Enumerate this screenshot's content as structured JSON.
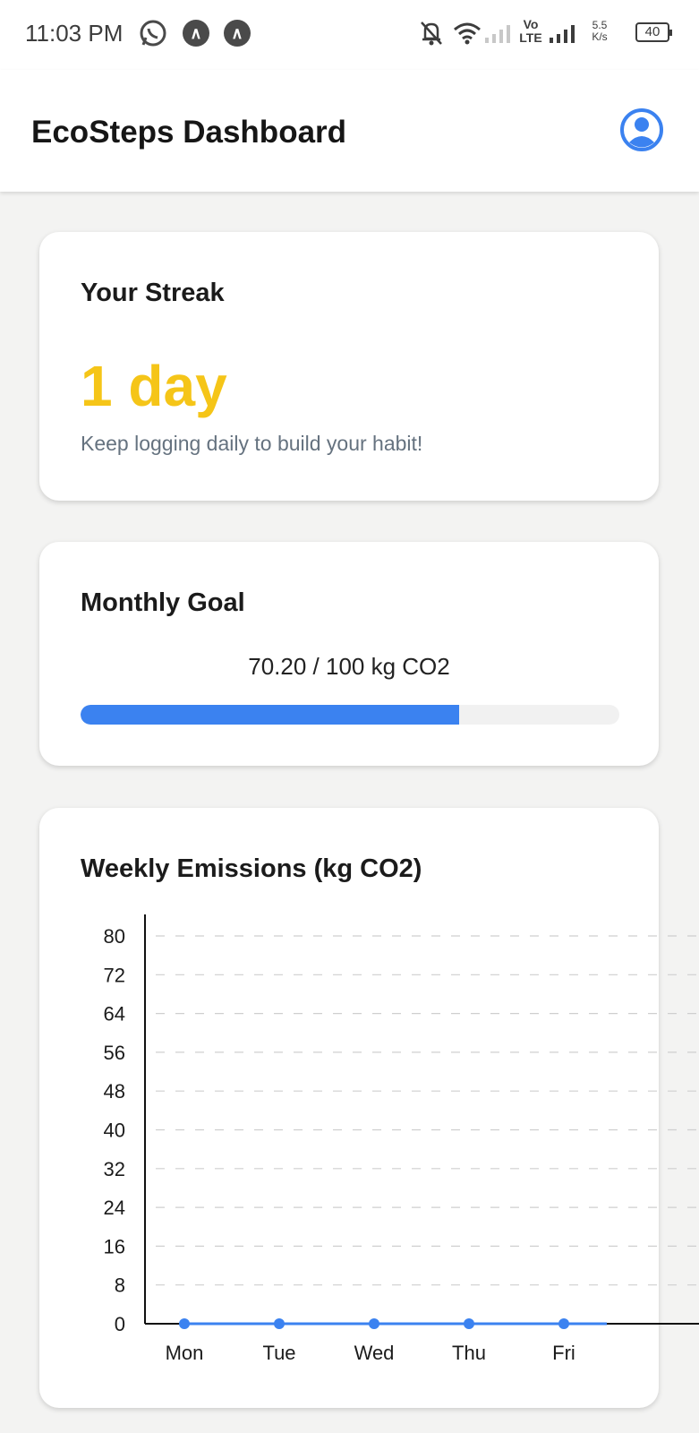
{
  "status_bar": {
    "time": "11:03 PM",
    "network_type": "Vo LTE",
    "speed_value": "5.5",
    "speed_unit": "K/s",
    "battery": "40",
    "icons": [
      "whatsapp-icon",
      "app-notification-icon",
      "app-notification-icon",
      "bell-off-icon",
      "wifi-icon",
      "signal-icon",
      "signal-icon",
      "battery-icon"
    ]
  },
  "header": {
    "title": "EcoSteps Dashboard",
    "profile_icon": "user-circle-icon"
  },
  "streak": {
    "title": "Your Streak",
    "value": "1 day",
    "message": "Keep logging daily to build your habit!"
  },
  "goal": {
    "title": "Monthly Goal",
    "text": "70.20 / 100 kg CO2",
    "progress": 0.702
  },
  "weekly": {
    "title": "Weekly Emissions (kg CO2)"
  },
  "colors": {
    "accent": "#3b82f0",
    "streak": "#f5c518",
    "muted_text": "#65727f"
  },
  "chart_data": {
    "type": "line",
    "categories": [
      "Mon",
      "Tue",
      "Wed",
      "Thu",
      "Fri"
    ],
    "values": [
      0,
      0,
      0,
      0,
      0
    ],
    "title": "Weekly Emissions (kg CO2)",
    "y_ticks": [
      0,
      8,
      16,
      24,
      32,
      40,
      48,
      56,
      64,
      72,
      80
    ],
    "ylim": [
      0,
      80
    ],
    "grid": true,
    "color": "#3b82f0"
  }
}
